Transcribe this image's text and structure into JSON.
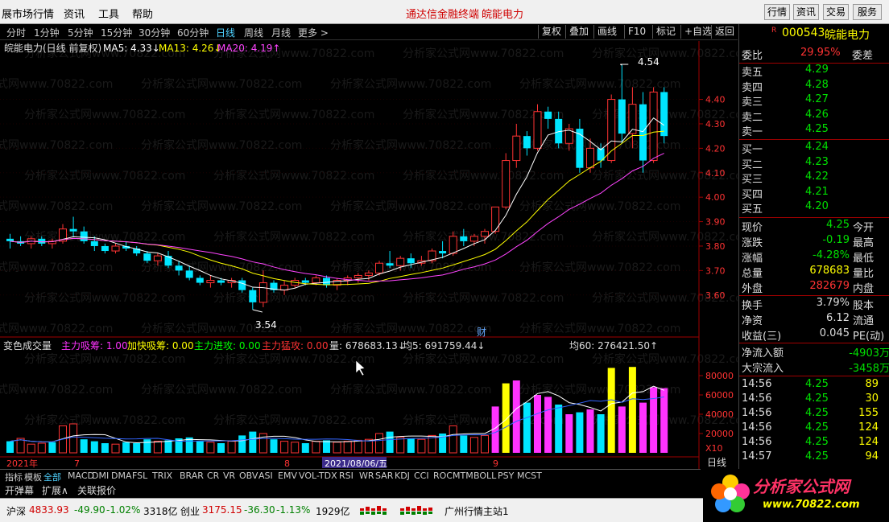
{
  "menubar": {
    "items": [
      "展市场行情",
      "资讯",
      "工具",
      "帮助"
    ],
    "center_title": "通达信金融终端",
    "center_stock": "皖能电力",
    "right_buttons": [
      "行情",
      "资讯",
      "交易",
      "服务"
    ]
  },
  "periods": [
    "分时",
    "1分钟",
    "5分钟",
    "15分钟",
    "30分钟",
    "60分钟",
    "日线",
    "周线",
    "月线",
    "更多 >"
  ],
  "active_period": "日线",
  "chart_tools": [
    "复权",
    "叠加",
    "画线",
    "F10",
    "标记",
    "+自选",
    "返回"
  ],
  "main_legend": {
    "title": "皖能电力(日线 前复权)",
    "ma5": "MA5: 4.33↓",
    "ma13": "MA13: 4.26↓",
    "ma20": "MA20: 4.19↑"
  },
  "price_axis": [
    "4.40",
    "4.30",
    "4.20",
    "4.10",
    "4.00",
    "3.90",
    "3.80",
    "3.70",
    "3.60"
  ],
  "volume_axis": [
    "80000",
    "60000",
    "40000",
    "20000",
    "X10"
  ],
  "high_label": "4.54",
  "low_label": "3.54",
  "event_marker": "财",
  "sub_legend": {
    "name": "变色成交量",
    "z1": "主力吸筹: 1.00",
    "z2": "加快吸筹: 0.00",
    "z3": "主力进攻: 0.00",
    "z4": "主力猛攻: 0.00",
    "vol": "量: 678683.13↓",
    "avg5": "均5: 691759.44↓",
    "avg60": "均60: 276421.50↑"
  },
  "date_axis": {
    "left": "2021年",
    "m7": "7",
    "m8": "8",
    "cursor_date": "2021/08/06/五",
    "m9": "9",
    "period_label": "日线"
  },
  "watermark": "分析家公式网www.70822.com",
  "quote": {
    "code": "000543",
    "name": "皖能电力",
    "r_tag": "R",
    "weibi_label": "委比",
    "weibi_value": "29.95%",
    "weicha_label": "委差",
    "asks": [
      {
        "label": "卖五",
        "price": "4.29"
      },
      {
        "label": "卖四",
        "price": "4.28"
      },
      {
        "label": "卖三",
        "price": "4.27"
      },
      {
        "label": "卖二",
        "price": "4.26"
      },
      {
        "label": "卖一",
        "price": "4.25"
      }
    ],
    "bids": [
      {
        "label": "买一",
        "price": "4.24"
      },
      {
        "label": "买二",
        "price": "4.23"
      },
      {
        "label": "买三",
        "price": "4.22"
      },
      {
        "label": "买四",
        "price": "4.21"
      },
      {
        "label": "买五",
        "price": "4.20"
      }
    ],
    "stats": [
      {
        "label": "现价",
        "value": "4.25",
        "label2": "今开"
      },
      {
        "label": "涨跌",
        "value": "-0.19",
        "label2": "最高"
      },
      {
        "label": "涨幅",
        "value": "-4.28%",
        "label2": "最低"
      },
      {
        "label": "总量",
        "value": "678683",
        "label2": "量比"
      },
      {
        "label": "外盘",
        "value": "282679",
        "label2": "内盘"
      }
    ],
    "stats2": [
      {
        "label": "换手",
        "value": "3.79%",
        "label2": "股本"
      },
      {
        "label": "净资",
        "value": "6.12",
        "label2": "流通"
      },
      {
        "label": "收益(三)",
        "value": "0.045",
        "label2": "PE(动)"
      }
    ],
    "flows": [
      {
        "label": "净流入额",
        "value": "-4903万"
      },
      {
        "label": "大宗流入",
        "value": "-3458万"
      }
    ],
    "ticks": [
      {
        "time": "14:56",
        "price": "4.25",
        "vol": "89"
      },
      {
        "time": "14:56",
        "price": "4.25",
        "vol": "30"
      },
      {
        "time": "14:56",
        "price": "4.25",
        "vol": "155"
      },
      {
        "time": "14:56",
        "price": "4.25",
        "vol": "124"
      },
      {
        "time": "14:56",
        "price": "4.25",
        "vol": "124"
      },
      {
        "time": "14:57",
        "price": "4.25",
        "vol": "94"
      }
    ]
  },
  "indicator_tabs": [
    "指标",
    "模板",
    "全部",
    "MACD",
    "DMI",
    "DMA",
    "FSL",
    "TRIX",
    "BRAR",
    "CR",
    "VR",
    "OBV",
    "ASI",
    "EMV",
    "VOL-TDX",
    "RSI",
    "WR",
    "SAR",
    "KDJ",
    "CCI",
    "ROC",
    "MTM",
    "BOLL",
    "PSY",
    "MCST"
  ],
  "bottom_tools": [
    "开弹幕",
    "扩展∧",
    "关联报价"
  ],
  "status": {
    "sh_label": "沪深",
    "sh_value": "4833.93",
    "sh_chg": "-49.90",
    "sh_pct": "-1.02%",
    "sh_amt": "3318亿",
    "cy_label": "创业",
    "cy_value": "3175.15",
    "cy_chg": "-36.30",
    "cy_pct": "-1.13%",
    "cy_amt": "1929亿",
    "server": "广州行情主站1"
  },
  "logo": {
    "title": "分析家公式网",
    "url": "www.70822.com"
  },
  "colors": {
    "up": "#ff3333",
    "down": "#00e5ff",
    "ma5": "#ffffff",
    "ma13": "#ffff00",
    "ma20": "#ff44ff",
    "vol_magenta": "#ff33ff",
    "vol_yellow": "#ffff00"
  },
  "chart_data": {
    "type": "candlestick",
    "ylim": [
      3.54,
      4.54
    ],
    "ohlc": [
      [
        3.83,
        3.85,
        3.79,
        3.82
      ],
      [
        3.82,
        3.84,
        3.8,
        3.81
      ],
      [
        3.81,
        3.84,
        3.79,
        3.83
      ],
      [
        3.83,
        3.84,
        3.8,
        3.81
      ],
      [
        3.81,
        3.83,
        3.79,
        3.82
      ],
      [
        3.82,
        3.89,
        3.81,
        3.87
      ],
      [
        3.87,
        3.92,
        3.84,
        3.86
      ],
      [
        3.86,
        3.88,
        3.81,
        3.82
      ],
      [
        3.82,
        3.84,
        3.78,
        3.8
      ],
      [
        3.8,
        3.81,
        3.77,
        3.78
      ],
      [
        3.78,
        3.81,
        3.77,
        3.8
      ],
      [
        3.8,
        3.82,
        3.78,
        3.79
      ],
      [
        3.79,
        3.8,
        3.76,
        3.77
      ],
      [
        3.77,
        3.78,
        3.73,
        3.74
      ],
      [
        3.74,
        3.77,
        3.72,
        3.76
      ],
      [
        3.76,
        3.78,
        3.71,
        3.72
      ],
      [
        3.72,
        3.74,
        3.68,
        3.7
      ],
      [
        3.7,
        3.72,
        3.66,
        3.67
      ],
      [
        3.67,
        3.68,
        3.64,
        3.65
      ],
      [
        3.65,
        3.68,
        3.63,
        3.66
      ],
      [
        3.66,
        3.67,
        3.64,
        3.65
      ],
      [
        3.65,
        3.67,
        3.63,
        3.66
      ],
      [
        3.66,
        3.67,
        3.61,
        3.62
      ],
      [
        3.62,
        3.63,
        3.54,
        3.57
      ],
      [
        3.57,
        3.7,
        3.55,
        3.65
      ],
      [
        3.65,
        3.66,
        3.61,
        3.62
      ],
      [
        3.62,
        3.66,
        3.6,
        3.64
      ],
      [
        3.64,
        3.67,
        3.63,
        3.66
      ],
      [
        3.66,
        3.67,
        3.64,
        3.65
      ],
      [
        3.65,
        3.68,
        3.64,
        3.67
      ],
      [
        3.67,
        3.68,
        3.63,
        3.64
      ],
      [
        3.64,
        3.67,
        3.62,
        3.66
      ],
      [
        3.66,
        3.68,
        3.64,
        3.67
      ],
      [
        3.67,
        3.69,
        3.65,
        3.68
      ],
      [
        3.68,
        3.7,
        3.66,
        3.69
      ],
      [
        3.69,
        3.74,
        3.68,
        3.73
      ],
      [
        3.73,
        3.78,
        3.71,
        3.72
      ],
      [
        3.72,
        3.76,
        3.7,
        3.75
      ],
      [
        3.75,
        3.77,
        3.71,
        3.73
      ],
      [
        3.73,
        3.76,
        3.72,
        3.74
      ],
      [
        3.74,
        3.79,
        3.73,
        3.78
      ],
      [
        3.78,
        3.82,
        3.75,
        3.77
      ],
      [
        3.77,
        3.86,
        3.76,
        3.84
      ],
      [
        3.84,
        3.87,
        3.8,
        3.82
      ],
      [
        3.82,
        3.85,
        3.8,
        3.84
      ],
      [
        3.84,
        3.87,
        3.81,
        3.86
      ],
      [
        3.86,
        3.94,
        3.85,
        3.96
      ],
      [
        3.96,
        4.18,
        3.95,
        4.15
      ],
      [
        4.15,
        4.3,
        4.12,
        4.25
      ],
      [
        4.25,
        4.27,
        4.17,
        4.2
      ],
      [
        4.2,
        4.38,
        4.19,
        4.35
      ],
      [
        4.35,
        4.37,
        4.28,
        4.32
      ],
      [
        4.32,
        4.35,
        4.2,
        4.22
      ],
      [
        4.22,
        4.3,
        4.19,
        4.28
      ],
      [
        4.28,
        4.32,
        4.1,
        4.12
      ],
      [
        4.12,
        4.24,
        4.1,
        4.2
      ],
      [
        4.2,
        4.22,
        4.12,
        4.15
      ],
      [
        4.15,
        4.42,
        4.14,
        4.4
      ],
      [
        4.4,
        4.54,
        4.22,
        4.26
      ],
      [
        4.26,
        4.45,
        4.2,
        4.38
      ],
      [
        4.38,
        4.43,
        4.1,
        4.15
      ],
      [
        4.15,
        4.45,
        4.14,
        4.43
      ],
      [
        4.43,
        4.45,
        4.22,
        4.25
      ]
    ],
    "volume": [
      12000,
      15000,
      9000,
      10000,
      11000,
      28000,
      30000,
      14000,
      12000,
      10000,
      9000,
      11000,
      10000,
      14000,
      12000,
      13000,
      15000,
      16000,
      12000,
      11000,
      10000,
      12000,
      18000,
      22000,
      20000,
      14000,
      12000,
      11000,
      10000,
      12000,
      13000,
      11000,
      12000,
      13000,
      14000,
      20000,
      22000,
      16000,
      15000,
      14000,
      18000,
      20000,
      28000,
      18000,
      16000,
      18000,
      48000,
      72000,
      75000,
      52000,
      60000,
      58000,
      50000,
      40000,
      42000,
      45000,
      40000,
      88000,
      48000,
      89000,
      52000,
      68000,
      67000
    ],
    "vol_colors": [
      "c",
      "r",
      "r",
      "r",
      "c",
      "r",
      "r",
      "c",
      "c",
      "c",
      "r",
      "c",
      "c",
      "c",
      "r",
      "c",
      "c",
      "c",
      "c",
      "r",
      "c",
      "r",
      "c",
      "c",
      "r",
      "c",
      "r",
      "r",
      "c",
      "r",
      "c",
      "r",
      "r",
      "r",
      "r",
      "r",
      "c",
      "r",
      "c",
      "r",
      "r",
      "c",
      "r",
      "c",
      "r",
      "r",
      "m",
      "y",
      "m",
      "c",
      "m",
      "m",
      "c",
      "m",
      "c",
      "m",
      "c",
      "y",
      "m",
      "y",
      "m",
      "m",
      "m"
    ]
  }
}
